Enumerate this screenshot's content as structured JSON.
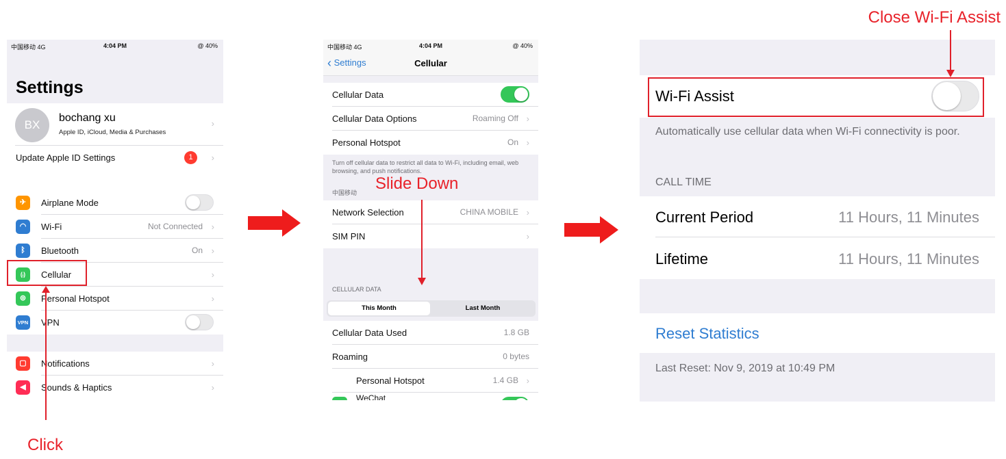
{
  "annotations": {
    "click": "Click",
    "slide_down": "Slide Down",
    "close_wifi_assist": "Close Wi-Fi Assist"
  },
  "colors": {
    "annotation_red": "#e8222a",
    "ios_green": "#34c759",
    "ios_blue": "#2f7dd1"
  },
  "screen1": {
    "status": {
      "carrier": "中国移动 4G",
      "time": "4:04 PM",
      "battery": "@ 40%"
    },
    "title": "Settings",
    "profile": {
      "initials": "BX",
      "name": "bochang xu",
      "subtitle": "Apple ID, iCloud, Media & Purchases"
    },
    "update_row": {
      "label": "Update Apple ID Settings",
      "badge": "1"
    },
    "items": [
      {
        "label": "Airplane Mode",
        "icon": "airplane-icon",
        "value": ""
      },
      {
        "label": "Wi-Fi",
        "icon": "wifi-icon",
        "value": "Not Connected"
      },
      {
        "label": "Bluetooth",
        "icon": "bluetooth-icon",
        "value": "On"
      },
      {
        "label": "Cellular",
        "icon": "antenna-icon",
        "value": ""
      },
      {
        "label": "Personal Hotspot",
        "icon": "hotspot-icon",
        "value": ""
      },
      {
        "label": "VPN",
        "icon": "vpn-icon",
        "icon_text": "VPN",
        "value": ""
      }
    ],
    "items2": [
      {
        "label": "Notifications",
        "icon": "notifications-icon"
      },
      {
        "label": "Sounds & Haptics",
        "icon": "sound-icon"
      }
    ]
  },
  "screen2": {
    "status": {
      "carrier": "中国移动 4G",
      "time": "4:04 PM",
      "battery": "@ 40%"
    },
    "back_label": "Settings",
    "title": "Cellular",
    "rows1": [
      {
        "label": "Cellular Data",
        "value": ""
      },
      {
        "label": "Cellular Data Options",
        "value": "Roaming Off"
      },
      {
        "label": "Personal Hotspot",
        "value": "On"
      }
    ],
    "footnote": "Turn off cellular data to restrict all data to Wi-Fi, including email, web browsing, and push notifications.",
    "carrier_header": "中国移动",
    "rows2": [
      {
        "label": "Network Selection",
        "value": "CHINA MOBILE"
      },
      {
        "label": "SIM PIN",
        "value": ""
      }
    ],
    "cellular_data_header": "CELLULAR DATA",
    "segments": [
      "This Month",
      "Last Month"
    ],
    "rows3": [
      {
        "label": "Cellular Data Used",
        "value": "1.8 GB"
      },
      {
        "label": "Roaming",
        "value": "0 bytes"
      },
      {
        "label": "Personal Hotspot",
        "value": "1.4 GB"
      }
    ],
    "partial_row": "WeChat"
  },
  "screen3": {
    "wifi_assist_label": "Wi-Fi Assist",
    "wifi_assist_desc": "Automatically use cellular data when Wi-Fi connectivity is poor.",
    "call_time_header": "CALL TIME",
    "rows": [
      {
        "label": "Current Period",
        "value": "11 Hours, 11 Minutes"
      },
      {
        "label": "Lifetime",
        "value": "11 Hours, 11 Minutes"
      }
    ],
    "reset_label": "Reset Statistics",
    "last_reset": "Last Reset: Nov 9, 2019 at 10:49 PM"
  }
}
